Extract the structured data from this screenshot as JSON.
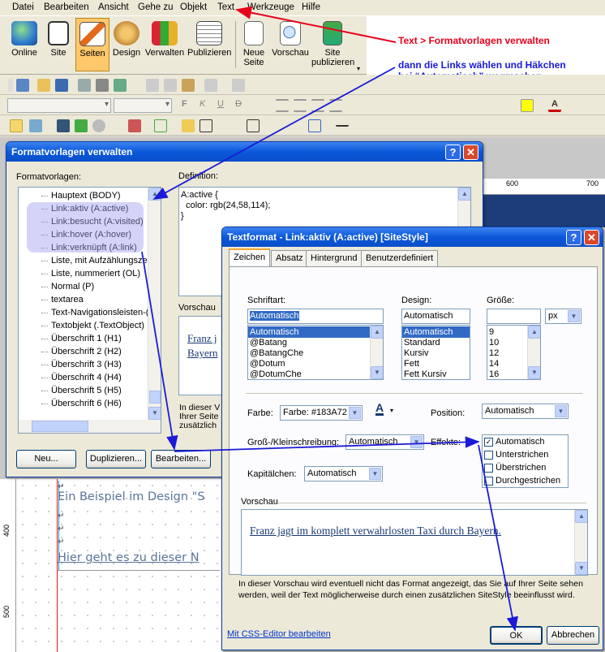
{
  "menu": [
    "Datei",
    "Bearbeiten",
    "Ansicht",
    "Gehe zu",
    "Objekt",
    "Text",
    "Werkzeuge",
    "Hilfe"
  ],
  "big_toolbar": [
    {
      "label": "Online",
      "icon": "globe-icon"
    },
    {
      "label": "Site",
      "icon": "site-icon"
    },
    {
      "label": "Seiten",
      "icon": "pages-icon",
      "active": true
    },
    {
      "label": "Design",
      "icon": "palette-icon"
    },
    {
      "label": "Verwalten",
      "icon": "manage-icon"
    },
    {
      "label": "Publizieren",
      "icon": "publish-icon"
    },
    {
      "label": "Neue Seite",
      "icon": "new-page-icon"
    },
    {
      "label": "Vorschau",
      "icon": "preview-icon"
    },
    {
      "label": "Site publizieren",
      "icon": "site-publish-icon"
    }
  ],
  "annotations": {
    "a1": "Text > Formatvorlagen verwalten",
    "a2_line1": "dann die Links wählen und Häkchen",
    "a2_line2": "bei “Automatisch” wegmachen"
  },
  "format_bar": {
    "bold": "F",
    "italic": "K",
    "underline": "U",
    "strike": "D"
  },
  "ruler": {
    "h1": "600",
    "h2": "700",
    "v1": "400",
    "v2": "500"
  },
  "editor": {
    "line1": "Ein Beispiel im Design \"S",
    "line2": "Hier geht es zu dieser N"
  },
  "dlg1": {
    "title": "Formatvorlagen verwalten",
    "list_label": "Formatvorlagen:",
    "def_label": "Definition:",
    "definition": [
      "A:active {",
      "  color: rgb(24,58,114);",
      "}"
    ],
    "preview_label": "Vorschau",
    "preview_text": [
      "Franz j",
      "Bayern"
    ],
    "note": [
      "In dieser V",
      "Ihrer Seite",
      "zusätzlich"
    ],
    "items": [
      "Hauptext (BODY)",
      "Link:aktiv (A:active)",
      "Link:besucht (A:visited)",
      "Link:hover (A:hover)",
      "Link:verknüpft (A:link)",
      "Liste, mit Aufzählungszei",
      "Liste, nummeriert (OL)",
      "Normal (P)",
      "textarea",
      "Text-Navigationsleisten-(",
      "Textobjekt (.TextObject)",
      "Überschrift 1 (H1)",
      "Überschrift 2 (H2)",
      "Überschrift 3 (H3)",
      "Überschrift 4 (H4)",
      "Überschrift 5 (H5)",
      "Überschrift 6 (H6)"
    ],
    "buttons": [
      "Neu...",
      "Duplizieren...",
      "Bearbeiten..."
    ]
  },
  "dlg2": {
    "title": "Textformat - Link:aktiv (A:active) [SiteStyle]",
    "tabs": [
      "Zeichen",
      "Absatz",
      "Hintergrund",
      "Benutzerdefiniert"
    ],
    "font_label": "Schriftart:",
    "font_value": "Automatisch",
    "fonts": [
      "Automatisch",
      "@Batang",
      "@BatangChe",
      "@Dotum",
      "@DotumChe"
    ],
    "design_label": "Design:",
    "design_value": "Automatisch",
    "designs": [
      "Automatisch",
      "Standard",
      "Kursiv",
      "Fett",
      "Fett Kursiv"
    ],
    "size_label": "Größe:",
    "size_value": "",
    "size_unit": "px",
    "sizes": [
      "9",
      "10",
      "12",
      "14",
      "16"
    ],
    "color_label": "Farbe:",
    "color_value": "Farbe: #183A72",
    "position_label": "Position:",
    "position_value": "Automatisch",
    "case_label": "Groß-/Kleinschreibung:",
    "case_value": "Automatisch",
    "effects_label": "Effekte:",
    "effects": [
      {
        "label": "Automatisch",
        "checked": true
      },
      {
        "label": "Unterstrichen",
        "checked": false
      },
      {
        "label": "Überstrichen",
        "checked": false
      },
      {
        "label": "Durchgestrichen",
        "checked": false
      }
    ],
    "smallcaps_label": "Kapitälchen:",
    "smallcaps_value": "Automatisch",
    "preview_label": "Vorschau",
    "preview_text": "Franz jagt im komplett verwahrlosten Taxi durch Bayern.",
    "note": "In dieser Vorschau wird eventuell nicht das Format angezeigt, das Sie auf Ihrer Seite sehen werden, weil der Text möglicherweise durch einen zusätzlichen SiteStyle beeinflusst wird.",
    "css_link": "Mit CSS-Editor bearbeiten",
    "ok": "OK",
    "cancel": "Abbrechen"
  },
  "colors": {
    "annotation_red": "#e8001c",
    "annotation_blue": "#1a1ad6",
    "link_color": "#183A72"
  }
}
